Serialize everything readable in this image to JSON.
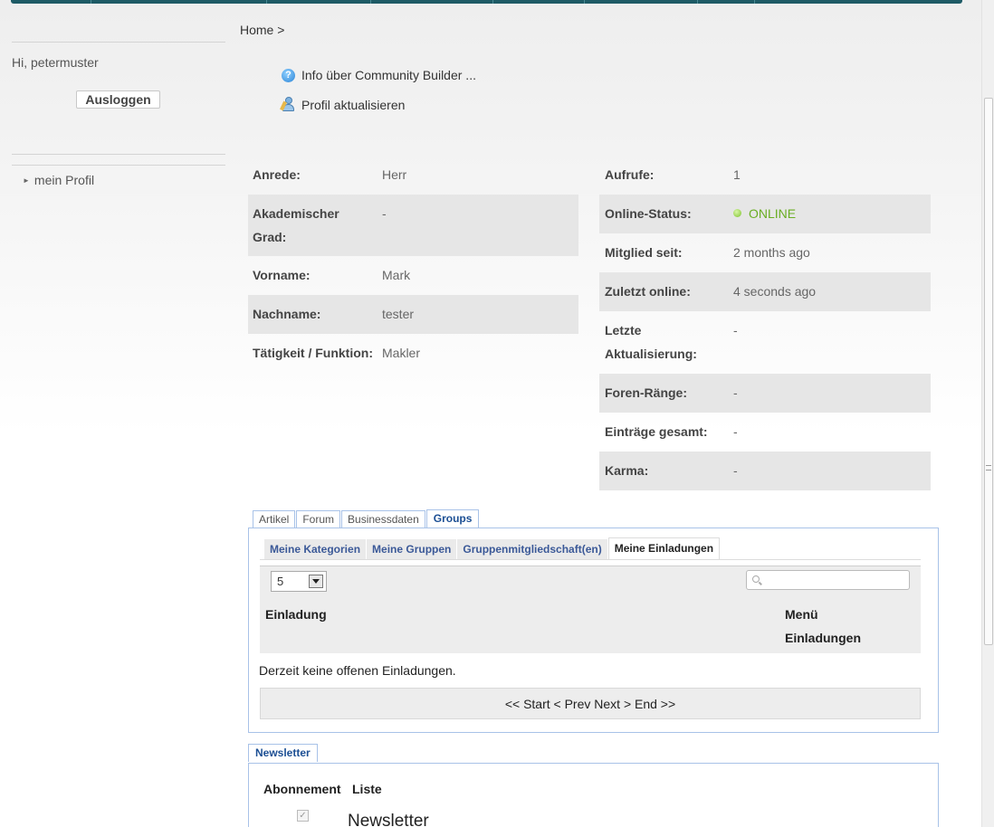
{
  "sidebar": {
    "greeting": "Hi, petermuster",
    "logout_label": "Ausloggen",
    "menu_item": "mein Profil"
  },
  "breadcrumb": "Home >",
  "actions": {
    "info": "Info über Community Builder ...",
    "update_profile": "Profil aktualisieren"
  },
  "profile_left": [
    {
      "label": "Anrede:",
      "value": "Herr"
    },
    {
      "label": "Akademischer Grad:",
      "value": "-"
    },
    {
      "label": "Vorname:",
      "value": "Mark"
    },
    {
      "label": "Nachname:",
      "value": "tester"
    },
    {
      "label": "Tätigkeit / Funktion:",
      "value": "Makler"
    }
  ],
  "profile_right": [
    {
      "label": "Aufrufe:",
      "value": "1"
    },
    {
      "label": "Online-Status:",
      "value": "ONLINE"
    },
    {
      "label": "Mitglied seit:",
      "value": "2 months ago"
    },
    {
      "label": "Zuletzt online:",
      "value": "4 seconds ago"
    },
    {
      "label": "Letzte Aktualisierung:",
      "value": "-"
    },
    {
      "label": "Foren-Ränge:",
      "value": "-"
    },
    {
      "label": "Einträge gesamt:",
      "value": "-"
    },
    {
      "label": "Karma:",
      "value": "-"
    }
  ],
  "tabs": [
    "Artikel",
    "Forum",
    "Businessdaten",
    "Groups"
  ],
  "active_tab": "Groups",
  "subtabs": [
    "Meine Kategorien",
    "Meine Gruppen",
    "Gruppenmitgliedschaft(en)",
    "Meine Einladungen"
  ],
  "active_subtab": "Meine Einladungen",
  "invitations": {
    "page_size": "5",
    "col_invitation": "Einladung",
    "col_menu": "Menü Einladungen",
    "empty_message": "Derzeit keine offenen Einladungen.",
    "pager": "<< Start < Prev Next > End >>"
  },
  "newsletter": {
    "tab_label": "Newsletter",
    "col_subscription": "Abonnement",
    "col_list": "Liste",
    "item_name": "Newsletter",
    "checked": true
  },
  "colors": {
    "online_green": "#6aae24",
    "tab_border": "#a8c2e8",
    "tab_active_text": "#1c4f94",
    "top_strip": "#1e5b66"
  }
}
